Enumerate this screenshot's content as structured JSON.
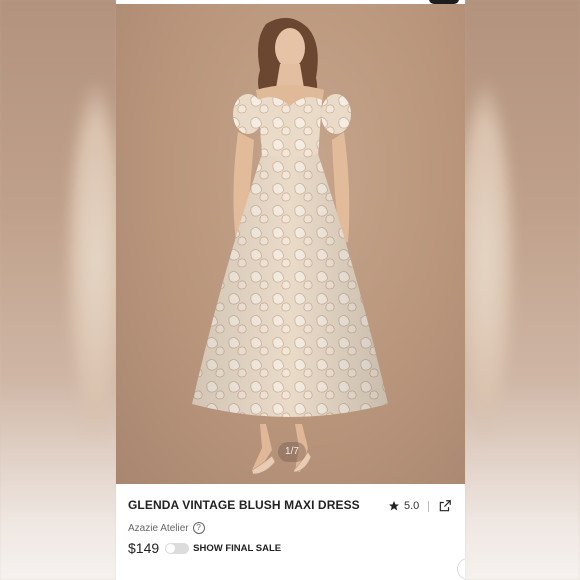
{
  "gallery": {
    "counter": "1/7"
  },
  "product": {
    "title": "GLENDA VINTAGE BLUSH MAXI DRESS",
    "rating": "5.0",
    "brand": "Azazie Atelier",
    "price": "$149",
    "final_sale_label": "SHOW FINAL SALE"
  },
  "icons": {
    "rating": "star-icon",
    "share": "share-external-icon",
    "brand_help": "help-circle-icon",
    "final_sale_toggle": "toggle-icon"
  },
  "colors": {
    "photo_background": "#b8957b",
    "dress": "#e8d8c6",
    "text_primary": "#222222"
  }
}
